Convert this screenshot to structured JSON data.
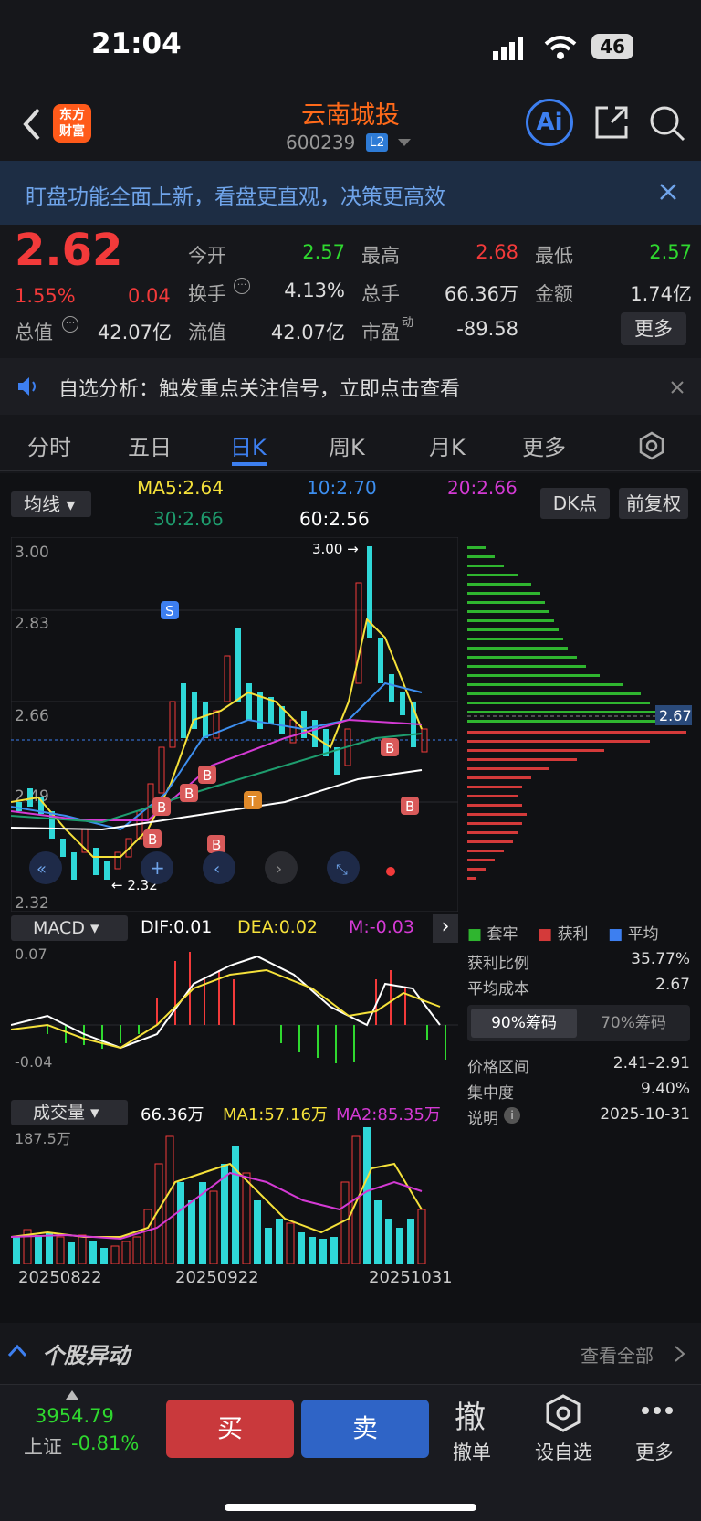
{
  "status_bar": {
    "time": "21:04",
    "battery": "46"
  },
  "header": {
    "logo_line1": "东方",
    "logo_line2": "财富",
    "stock_name": "云南城投",
    "stock_code": "600239",
    "l2_badge": "L2"
  },
  "banner": {
    "text": "盯盘功能全面上新，看盘更直观，决策更高效"
  },
  "quote": {
    "price": "2.62",
    "change_pct": "1.55%",
    "change": "0.04",
    "open_label": "今开",
    "open": "2.57",
    "high_label": "最高",
    "high": "2.68",
    "low_label": "最低",
    "low": "2.57",
    "turnover_label": "换手",
    "turnover": "4.13%",
    "volume_label": "总手",
    "volume": "66.36万",
    "amount_label": "金额",
    "amount": "1.74亿",
    "mktcap_label": "总值",
    "mktcap": "42.07亿",
    "float_label": "流值",
    "float_cap": "42.07亿",
    "pe_label": "市盈",
    "pe_sup": "动",
    "pe": "-89.58",
    "more": "更多"
  },
  "notice": {
    "text": "自选分析：触发重点关注信号，立即点击查看"
  },
  "tabs": [
    "分时",
    "五日",
    "日K",
    "周K",
    "月K",
    "更多"
  ],
  "active_tab": "日K",
  "kline": {
    "ma_selector": "均线",
    "ma5": "MA5:2.64",
    "ma10": "10:2.70",
    "ma20": "20:2.66",
    "ma30": "30:2.66",
    "ma60": "60:2.56",
    "dk_button": "DK点",
    "fq_button": "前复权",
    "y_labels": [
      "3.00",
      "2.83",
      "2.66",
      "2.49",
      "2.32"
    ],
    "high_mark": "3.00",
    "low_mark": "2.32",
    "cost_line": "2.67",
    "signal_s": "S",
    "signal_b": "B",
    "signal_t": "T"
  },
  "chip": {
    "legend": [
      "套牢",
      "获利",
      "平均"
    ],
    "profit_ratio_label": "获利比例",
    "profit_ratio": "35.77%",
    "avg_cost_label": "平均成本",
    "avg_cost": "2.67",
    "tab90": "90%筹码",
    "tab70": "70%筹码",
    "price_range_label": "价格区间",
    "price_range": "2.41–2.91",
    "concentration_label": "集中度",
    "concentration": "9.40%",
    "note_label": "说明",
    "note_date": "2025-10-31"
  },
  "macd": {
    "selector": "MACD",
    "dif": "DIF:0.01",
    "dea": "DEA:0.02",
    "m": "M:-0.03",
    "ymax": "0.07",
    "ymin": "-0.04"
  },
  "vol": {
    "selector": "成交量",
    "vol": "66.36万",
    "ma1": "MA1:57.16万",
    "ma2": "MA2:85.35万",
    "ymax": "187.5万",
    "dates": [
      "20250822",
      "20250922",
      "20251031"
    ]
  },
  "stock_move": {
    "title": "个股异动",
    "view_all": "查看全部"
  },
  "bottom": {
    "index_value": "3954.79",
    "index_name": "上证",
    "index_change": "-0.81%",
    "buy": "买",
    "sell": "卖",
    "cancel_glyph": "撤",
    "cancel_label": "撤单",
    "watch_label": "设自选",
    "more_label": "更多"
  },
  "colors": {
    "up": "#f23a3a",
    "down": "#2fd8d8",
    "accent": "#2e7bd6",
    "orange": "#ff6a1a"
  }
}
